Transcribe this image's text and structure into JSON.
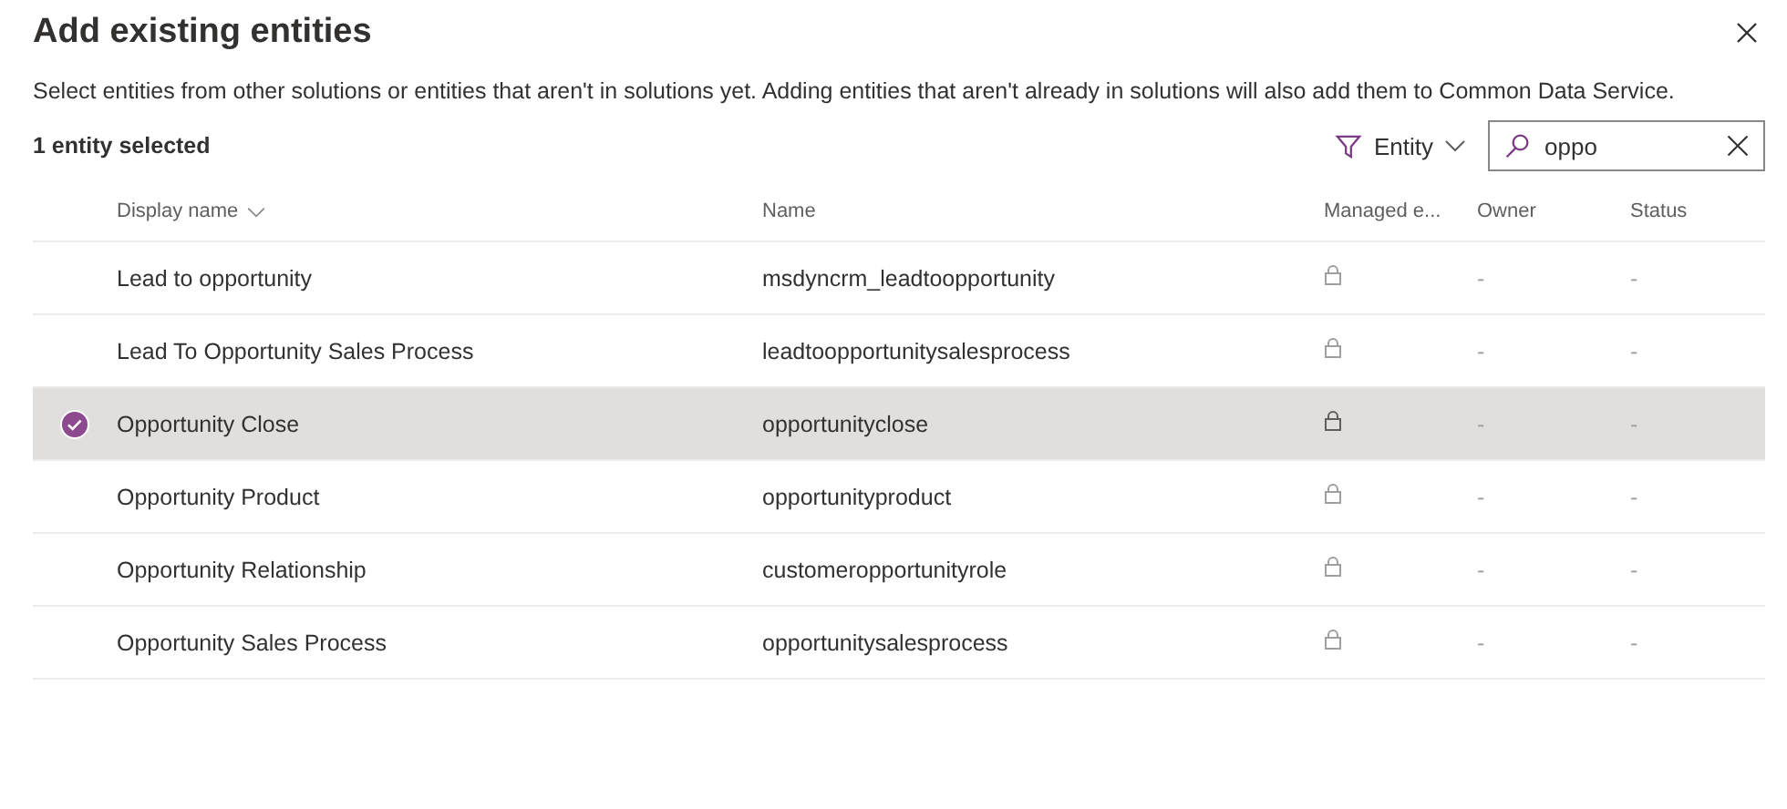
{
  "dialog": {
    "title": "Add existing entities",
    "description": "Select entities from other solutions or entities that aren't in solutions yet. Adding entities that aren't already in solutions will also add them to Common Data Service."
  },
  "selection_count": "1 entity selected",
  "filter": {
    "label": "Entity"
  },
  "search": {
    "value": "oppo"
  },
  "table": {
    "columns": [
      "Display name",
      "Name",
      "Managed e...",
      "Owner",
      "Status"
    ],
    "rows": [
      {
        "display_name": "Lead to opportunity",
        "name": "msdyncrm_leadtoopportunity",
        "owner": "-",
        "status": "-",
        "selected": false
      },
      {
        "display_name": "Lead To Opportunity Sales Process",
        "name": "leadtoopportunitysalesprocess",
        "owner": "-",
        "status": "-",
        "selected": false
      },
      {
        "display_name": "Opportunity Close",
        "name": "opportunityclose",
        "owner": "-",
        "status": "-",
        "selected": true
      },
      {
        "display_name": "Opportunity Product",
        "name": "opportunityproduct",
        "owner": "-",
        "status": "-",
        "selected": false
      },
      {
        "display_name": "Opportunity Relationship",
        "name": "customeropportunityrole",
        "owner": "-",
        "status": "-",
        "selected": false
      },
      {
        "display_name": "Opportunity Sales Process",
        "name": "opportunitysalesprocess",
        "owner": "-",
        "status": "-",
        "selected": false
      }
    ]
  }
}
